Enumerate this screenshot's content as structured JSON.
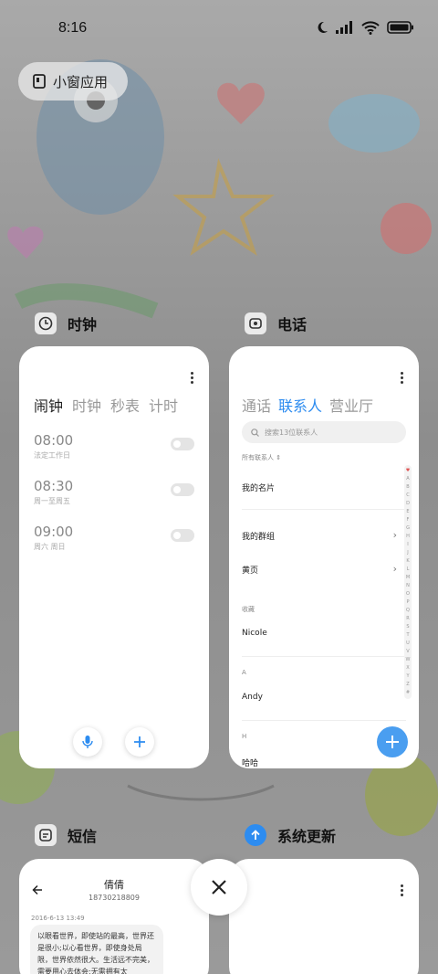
{
  "status_bar": {
    "time": "8:16"
  },
  "floating_window_chip": {
    "label": "小窗应用"
  },
  "cards": {
    "clock": {
      "app_name": "时钟",
      "tabs": [
        "闹钟",
        "时钟",
        "秒表",
        "计时"
      ],
      "alarms": [
        {
          "time": "08:00",
          "repeat": "法定工作日"
        },
        {
          "time": "08:30",
          "repeat": "周一至周五"
        },
        {
          "time": "09:00",
          "repeat": "周六 周日"
        }
      ]
    },
    "phone": {
      "app_name": "电话",
      "tabs": [
        "通话",
        "联系人",
        "营业厅"
      ],
      "search_placeholder": "搜索13位联系人",
      "all_contacts_label": "所有联系人",
      "my_card": "我的名片",
      "my_groups": "我的群组",
      "yellow_pages": "黄页",
      "favorites_header": "收藏",
      "favorite_contact": "Nicole",
      "section_a": "A",
      "contact_a": "Andy",
      "section_h": "H",
      "contact_h": "哈哈",
      "index_letters": [
        "♥",
        "A",
        "B",
        "C",
        "D",
        "E",
        "F",
        "G",
        "H",
        "I",
        "J",
        "K",
        "L",
        "M",
        "N",
        "O",
        "P",
        "Q",
        "R",
        "S",
        "T",
        "U",
        "V",
        "W",
        "X",
        "Y",
        "Z",
        "#"
      ]
    },
    "messages": {
      "app_name": "短信",
      "contact_name": "倩倩",
      "contact_number": "18730218809",
      "timestamp": "2016-6-13 13:49",
      "message_text": "以眼看世界，即使站的最高，世界还是很小;以心看世界，即使身处局限，世界依然很大。生活远不完美，需要用心去体会;无需拥有太"
    },
    "system_update": {
      "app_name": "系统更新"
    }
  },
  "colors": {
    "accent": "#2d8cf0",
    "fab": "#4a9ef0"
  }
}
